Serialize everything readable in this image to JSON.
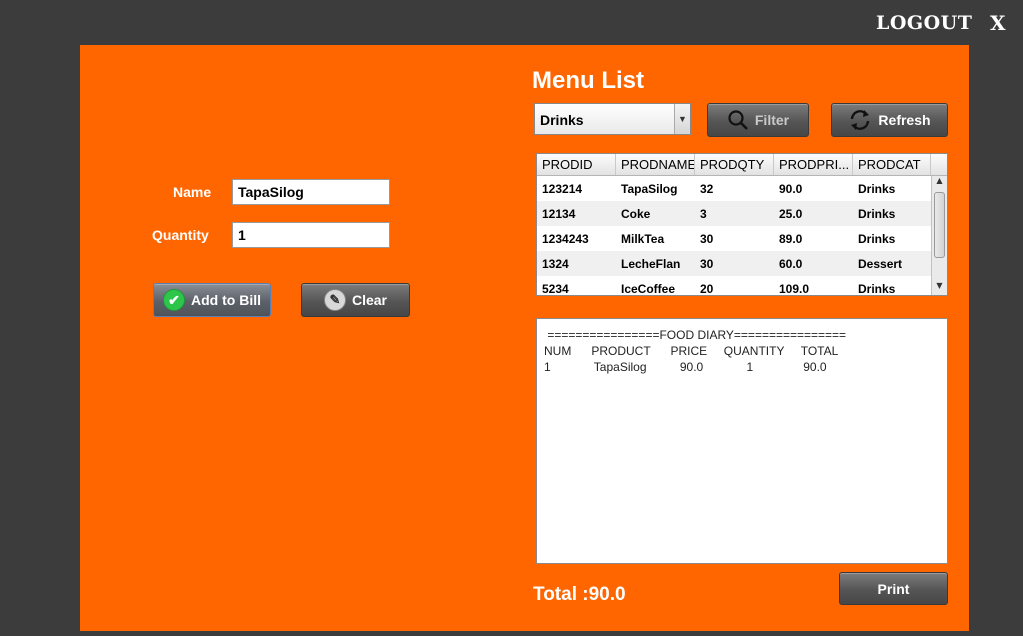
{
  "topbar": {
    "logout_label": "LOGOUT",
    "close_label": "X"
  },
  "form": {
    "name_label": "Name",
    "name_value": "TapaSilog",
    "quantity_label": "Quantity",
    "quantity_value": "1",
    "add_button_label": "Add to Bill",
    "clear_button_label": "Clear"
  },
  "menu": {
    "title": "Menu List",
    "category_selected": "Drinks",
    "filter_label": "Filter",
    "refresh_label": "Refresh",
    "columns": [
      "PRODID",
      "PRODNAME",
      "PRODQTY",
      "PRODPRI...",
      "PRODCAT"
    ],
    "rows": [
      [
        "123214",
        "TapaSilog",
        "32",
        "90.0",
        "Drinks"
      ],
      [
        "12134",
        "Coke",
        "3",
        "25.0",
        "Drinks"
      ],
      [
        "1234243",
        "MilkTea",
        "30",
        "89.0",
        "Drinks"
      ],
      [
        "1324",
        "LecheFlan",
        "30",
        "60.0",
        "Dessert"
      ],
      [
        "5234",
        "IceCoffee",
        "20",
        "109.0",
        "Drinks"
      ]
    ]
  },
  "bill": {
    "text": " ================FOOD DIARY================\nNUM      PRODUCT      PRICE     QUANTITY     TOTAL\n1             TapaSilog          90.0             1               90.0"
  },
  "footer": {
    "total_label": "Total :90.0",
    "print_label": "Print"
  }
}
